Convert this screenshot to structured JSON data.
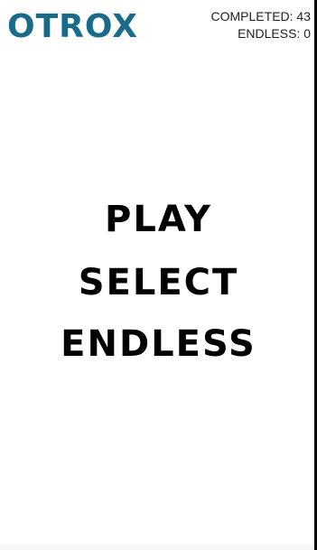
{
  "header": {
    "logo_text": "OTROX",
    "completed_text": "COMPLETED: 43",
    "endless_text": "ENDLESS: 0"
  },
  "menu": {
    "play": "PLAY",
    "select": "SELECT",
    "endless": "ENDLESS"
  },
  "colors": {
    "logo": "#1a6a8a",
    "menu_text": "#000000",
    "background": "#ffffff"
  }
}
